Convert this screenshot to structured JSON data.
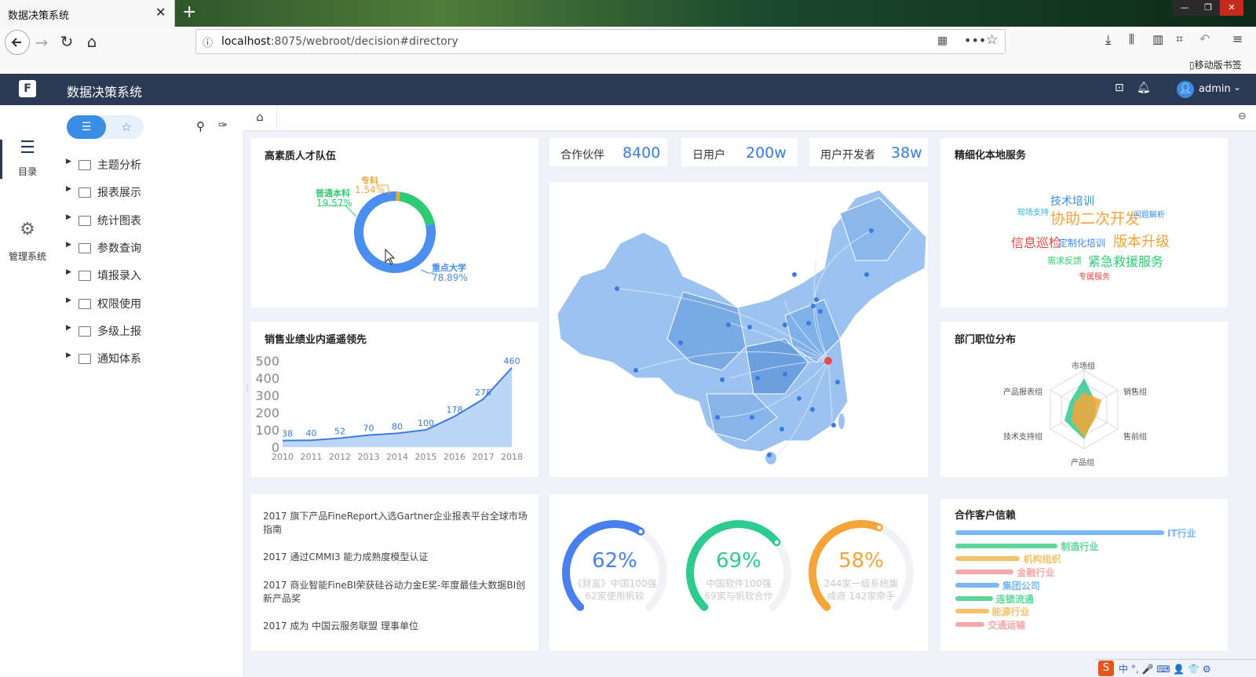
{
  "browser": {
    "tab_title": "数据决策系统",
    "tab_close": "✕",
    "new_tab": "+",
    "url_host": "localhost",
    "url_path": ":8075/webroot/decision#directory",
    "mobile_bookmarks": "▯移动版书签"
  },
  "app": {
    "title": "数据决策系统",
    "logo": "F",
    "user": "admin"
  },
  "rail": {
    "items": [
      {
        "label": "目录",
        "icon": "list-icon"
      },
      {
        "label": "管理系统",
        "icon": "gear-icon"
      }
    ]
  },
  "directory": {
    "items": [
      "主题分析",
      "报表展示",
      "统计图表",
      "参数查询",
      "填报录入",
      "权限使用",
      "多级上报",
      "通知体系"
    ]
  },
  "dashboard": {
    "talent": {
      "title": "高素质人才队伍",
      "slices": [
        {
          "name": "重点大学",
          "pct": "78.89%",
          "value": 78.89,
          "color": "#4a8ef0"
        },
        {
          "name": "普通本科",
          "pct": "19.57%",
          "value": 19.57,
          "color": "#2ecb72"
        },
        {
          "name": "专科",
          "pct": "1.54%",
          "value": 1.54,
          "color": "#f5a43a"
        }
      ]
    },
    "kpis": [
      {
        "label": "合作伙伴",
        "value": "8400"
      },
      {
        "label": "日用户",
        "value": "200w"
      },
      {
        "label": "用户开发者",
        "value": "38w"
      }
    ],
    "sales": {
      "title": "销售业绩业内遥遥领先"
    },
    "local_service": {
      "title": "精细化本地服务",
      "words": [
        {
          "text": "技术培训",
          "color": "#3a8ee6"
        },
        {
          "text": "现场支持",
          "color": "#2bb3d6"
        },
        {
          "text": "协助二次开发",
          "color": "#f5a43a"
        },
        {
          "text": "问题解析",
          "color": "#3a8ee6"
        },
        {
          "text": "信息巡检",
          "color": "#e84a4a"
        },
        {
          "text": "定制化培训",
          "color": "#3a8ee6"
        },
        {
          "text": "版本升级",
          "color": "#f5a43a"
        },
        {
          "text": "需求反馈",
          "color": "#2ecb72"
        },
        {
          "text": "紧急救援服务",
          "color": "#2ecb72"
        },
        {
          "text": "专属服务",
          "color": "#e84a4a"
        }
      ]
    },
    "departments": {
      "title": "部门职位分布",
      "axes": [
        "市场组",
        "销售组",
        "售前组",
        "产品组",
        "技术支持组",
        "产品报表组"
      ]
    },
    "news": [
      "2017 旗下产品FineReport入选Gartner企业报表平台全球市场指南",
      "2017 通过CMMI3 能力成熟度模型认证",
      "2017 商业智能FineBI荣获硅谷动力金E奖-年度最佳大数据BI创新产品奖",
      "2017 成为 中国云服务联盟 理事单位"
    ],
    "gauges": [
      {
        "pct": "62%",
        "value": 62,
        "line1": "《财富》中国100强",
        "line2": "62家使用帆软",
        "color": "#4a7ff0"
      },
      {
        "pct": "69%",
        "value": 69,
        "line1": "中国软件100强",
        "line2": "69家与帆软合作",
        "color": "#2ecb8f"
      },
      {
        "pct": "58%",
        "value": 58,
        "line1": "244家一级系统集",
        "line2": "成商 142家牵手",
        "color": "#f5a43a"
      }
    ],
    "customers": {
      "title": "合作客户信赖",
      "items": [
        {
          "name": "IT行业",
          "value": 1.0,
          "color": "#7ab8f5"
        },
        {
          "name": "制造行业",
          "value": 0.49,
          "color": "#5ed69a"
        },
        {
          "name": "机构组织",
          "value": 0.31,
          "color": "#f5c26b"
        },
        {
          "name": "金融行业",
          "value": 0.28,
          "color": "#f5a9a9"
        },
        {
          "name": "集团公司",
          "value": 0.21,
          "color": "#7ab8f5"
        },
        {
          "name": "连锁流通",
          "value": 0.18,
          "color": "#5ed69a"
        },
        {
          "name": "能源行业",
          "value": 0.16,
          "color": "#f5c26b"
        },
        {
          "name": "交通运输",
          "value": 0.14,
          "color": "#f5a9a9"
        }
      ]
    }
  },
  "chart_data": {
    "type": "area",
    "x": [
      "2010",
      "2011",
      "2012",
      "2013",
      "2014",
      "2015",
      "2016",
      "2017",
      "2018"
    ],
    "values": [
      38,
      40,
      52,
      70,
      80,
      100,
      178,
      278,
      460
    ],
    "yticks": [
      "500",
      "400",
      "300",
      "200",
      "100",
      "0"
    ],
    "ylim": [
      0,
      500
    ],
    "grid": false,
    "color": "#3a7be2"
  },
  "ime": {
    "text": "中 °, 🎤 ⌨ 👤 👕 ⚙"
  }
}
